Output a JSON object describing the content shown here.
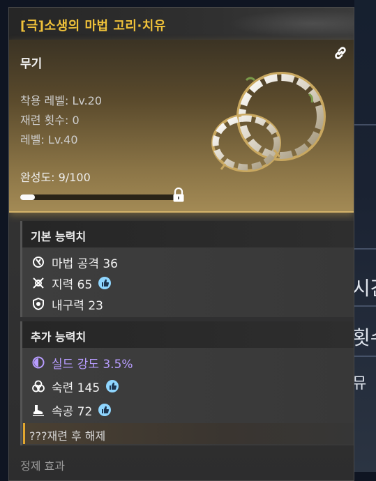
{
  "background": {
    "side_labels": [
      "시간",
      "횟수",
      "뮤"
    ]
  },
  "tooltip": {
    "title": "[극]소생의 마법 고리·치유",
    "item_type": "무기",
    "stats": [
      "착용 레벨: Lv.20",
      "재련 횟수: 0",
      "레벨: Lv.40"
    ],
    "completion_text": "완성도: 9/100",
    "completion_value": 9,
    "completion_max": 100,
    "base_section_title": "기본 능력치",
    "base_stats": [
      {
        "icon": "magic-attack-icon",
        "text": "마법 공격 36",
        "recommended": false
      },
      {
        "icon": "intellect-icon",
        "text": "지력 65",
        "recommended": true
      },
      {
        "icon": "durability-icon",
        "text": "내구력 23",
        "recommended": false
      }
    ],
    "extra_section_title": "추가 능력치",
    "extra_stats": [
      {
        "icon": "shield-strength-icon",
        "text": "실드 강도 3.5%",
        "recommended": false
      },
      {
        "icon": "proficiency-icon",
        "text": "숙련 145",
        "recommended": true
      },
      {
        "icon": "attack-speed-icon",
        "text": "속공 72",
        "recommended": true
      }
    ],
    "locked_stat_text": "???재련 후 해제",
    "refine_effect_label": "정제 효과"
  },
  "colors": {
    "title": "#f0c23a",
    "shield_stat": "#b79cff",
    "unlock_accent": "#e2a72f",
    "card_gold": "#a38a55"
  }
}
